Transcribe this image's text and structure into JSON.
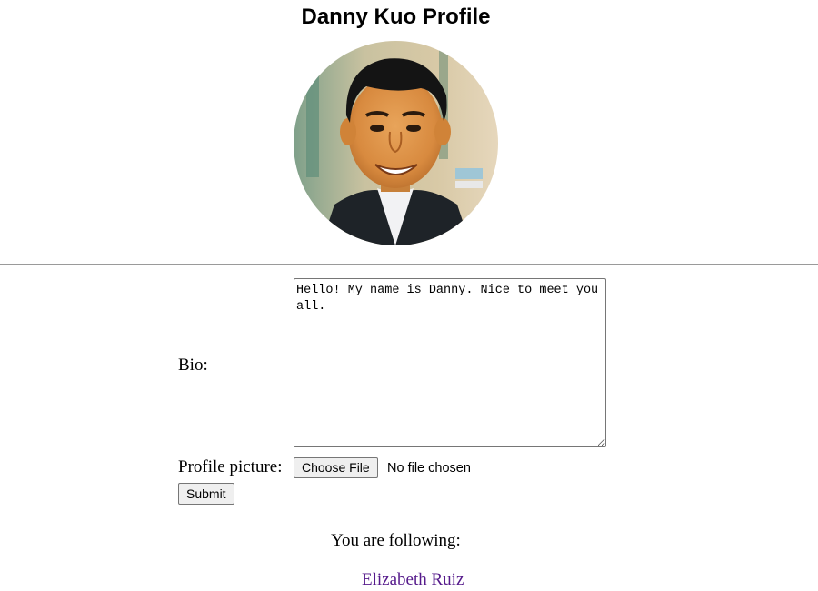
{
  "profile": {
    "title": "Danny Kuo Profile",
    "avatar_alt": "profile photo"
  },
  "form": {
    "bio_label": "Bio:",
    "bio_value": "Hello! My name is Danny. Nice to meet you all.",
    "picture_label": "Profile picture:",
    "choose_file_label": "Choose File",
    "file_status": "No file chosen",
    "submit_label": "Submit"
  },
  "following": {
    "label": "You are following:",
    "users": [
      "Elizabeth Ruiz"
    ]
  },
  "colors": {
    "visited_link": "#551a8b",
    "button_bg": "#efefef",
    "divider": "#9a9a9a"
  }
}
